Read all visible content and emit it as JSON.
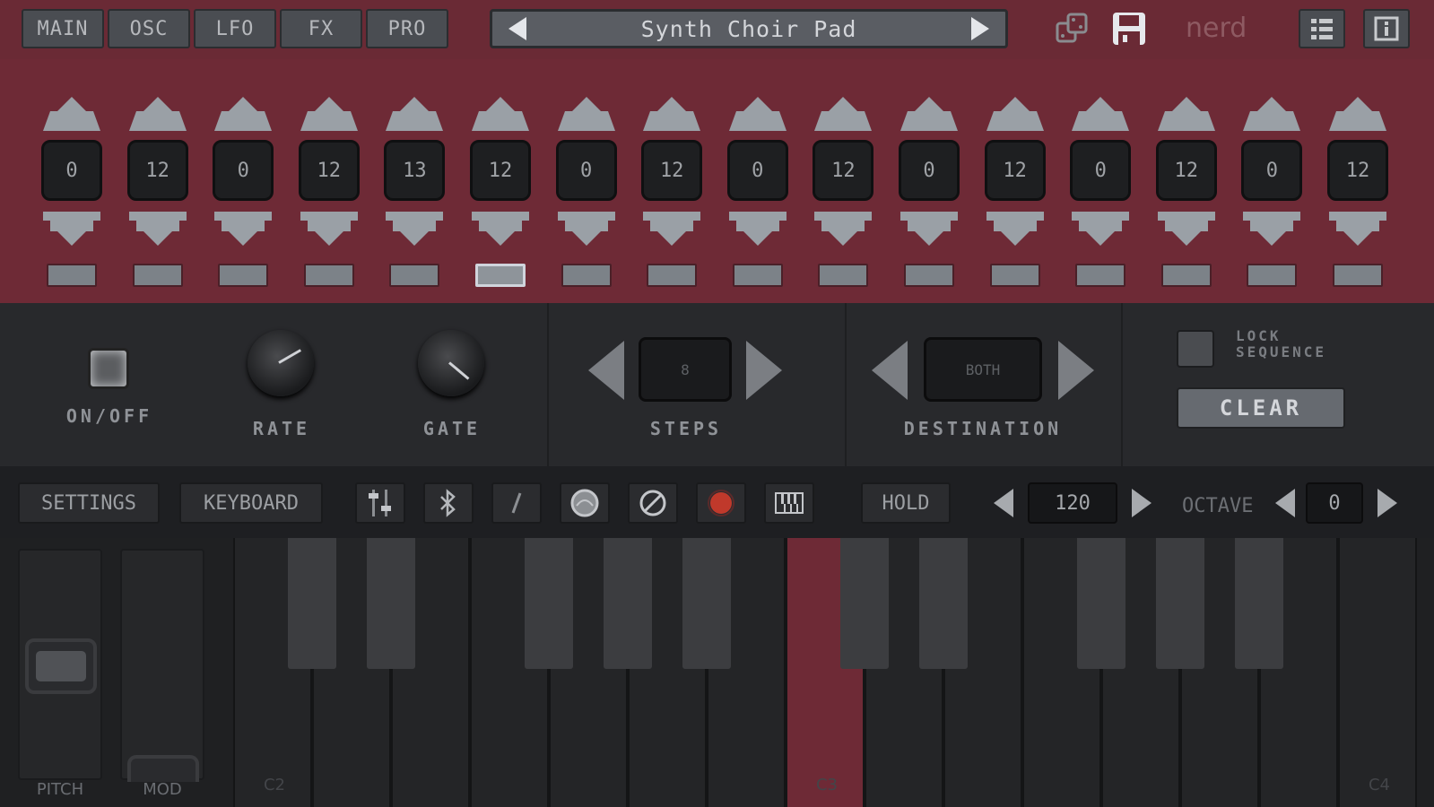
{
  "tabs": [
    {
      "label": "MAIN"
    },
    {
      "label": "OSC"
    },
    {
      "label": "LFO"
    },
    {
      "label": "FX"
    },
    {
      "label": "PRO"
    }
  ],
  "preset": {
    "name": "Synth Choir Pad"
  },
  "brand": "nerd",
  "icons": {
    "random": "dice-icon",
    "save": "floppy-disk-icon",
    "list": "list-icon",
    "info": "info-icon"
  },
  "sequencer": {
    "active_step": 6,
    "steps": [
      {
        "value": "0"
      },
      {
        "value": "12"
      },
      {
        "value": "0"
      },
      {
        "value": "12"
      },
      {
        "value": "13"
      },
      {
        "value": "12"
      },
      {
        "value": "0"
      },
      {
        "value": "12"
      },
      {
        "value": "0"
      },
      {
        "value": "12"
      },
      {
        "value": "0"
      },
      {
        "value": "12"
      },
      {
        "value": "0"
      },
      {
        "value": "12"
      },
      {
        "value": "0"
      },
      {
        "value": "12"
      }
    ]
  },
  "controls": {
    "onoff_label": "ON/OFF",
    "rate_label": "RATE",
    "gate_label": "GATE",
    "steps_label": "STEPS",
    "steps_value": "8",
    "destination_label": "DESTINATION",
    "destination_value": "BOTH",
    "lock_line1": "LOCK",
    "lock_line2": "SEQUENCE",
    "clear_label": "CLEAR"
  },
  "toolbar": {
    "settings_label": "SETTINGS",
    "keyboard_label": "KEYBOARD",
    "hold_label": "HOLD",
    "tempo_value": "120",
    "octave_label": "OCTAVE",
    "octave_value": "0",
    "record_color": "#c0392b"
  },
  "keyboard": {
    "pitch_label": "PITCH",
    "mod_label": "MOD",
    "key_labels": {
      "c2": "C2",
      "c3": "C3",
      "c4": "C4"
    },
    "accent_color": "#6e2a36"
  }
}
